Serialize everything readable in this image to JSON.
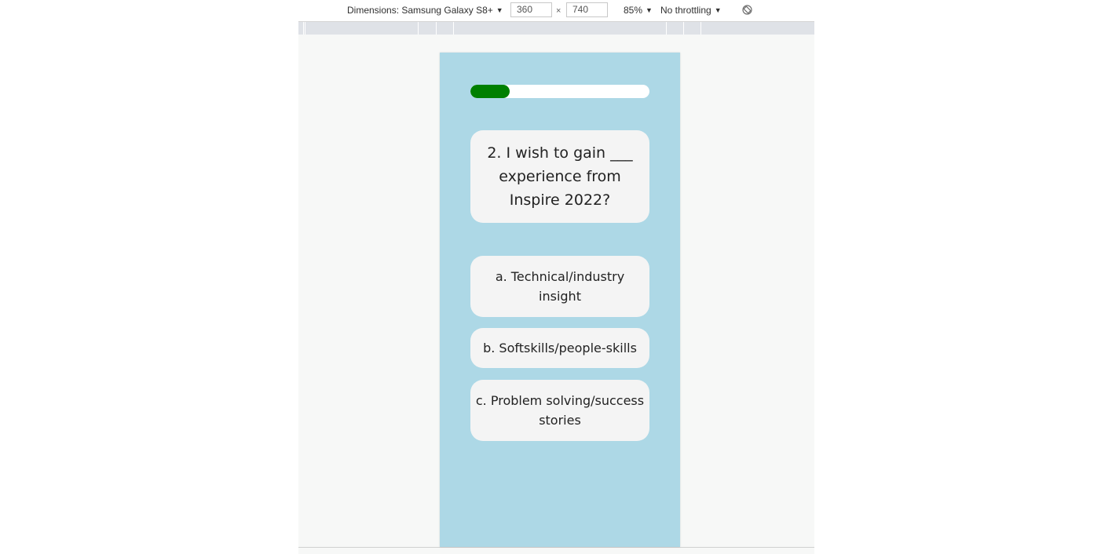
{
  "devtools": {
    "dimensions_label": "Dimensions: Samsung Galaxy S8+",
    "width_value": "360",
    "times_sign": "×",
    "height_value": "740",
    "zoom": "85%",
    "throttling": "No throttling",
    "caret": "▼"
  },
  "quiz": {
    "progress_fraction": 0.22,
    "progress_color": "#008000",
    "background_color": "#add8e6",
    "question": "2. I wish to gain ___ experience from Inspire 2022?",
    "options": [
      {
        "label": "a. Technical/industry insight"
      },
      {
        "label": "b. Softskills/people-skills"
      },
      {
        "label": "c. Problem solving/success stories"
      }
    ]
  }
}
